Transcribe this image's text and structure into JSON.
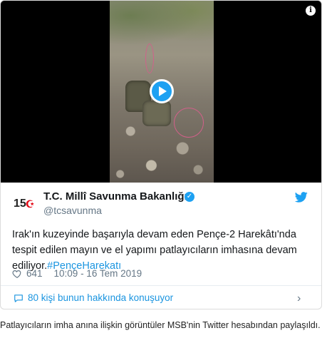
{
  "media": {
    "play_icon": "play-icon",
    "info_icon_label": "i"
  },
  "tweet": {
    "avatar_text": "15",
    "author_name": "T.C. Millî Savunma Bakanlığı",
    "verified_icon": "✓",
    "handle": "@tcsavunma",
    "body": "Irak'ın kuzeyinde başarıyla devam eden Pençe-2 Harekâtı'nda tespit edilen mayın ve el yapımı patlayıcıların imhasına devam ediliyor.",
    "hashtag": "#PençeHarekatı",
    "likes": "641",
    "timestamp": "10:09 - 16 Tem 2019",
    "conversation_text": "80 kişi bunun hakkında konuşuyor",
    "chevron": "›",
    "accent_color": "#1da1f2"
  },
  "caption": "Patlayıcıların imha anına ilişkin görüntüler MSB'nin Twitter hesabından paylaşıldı."
}
